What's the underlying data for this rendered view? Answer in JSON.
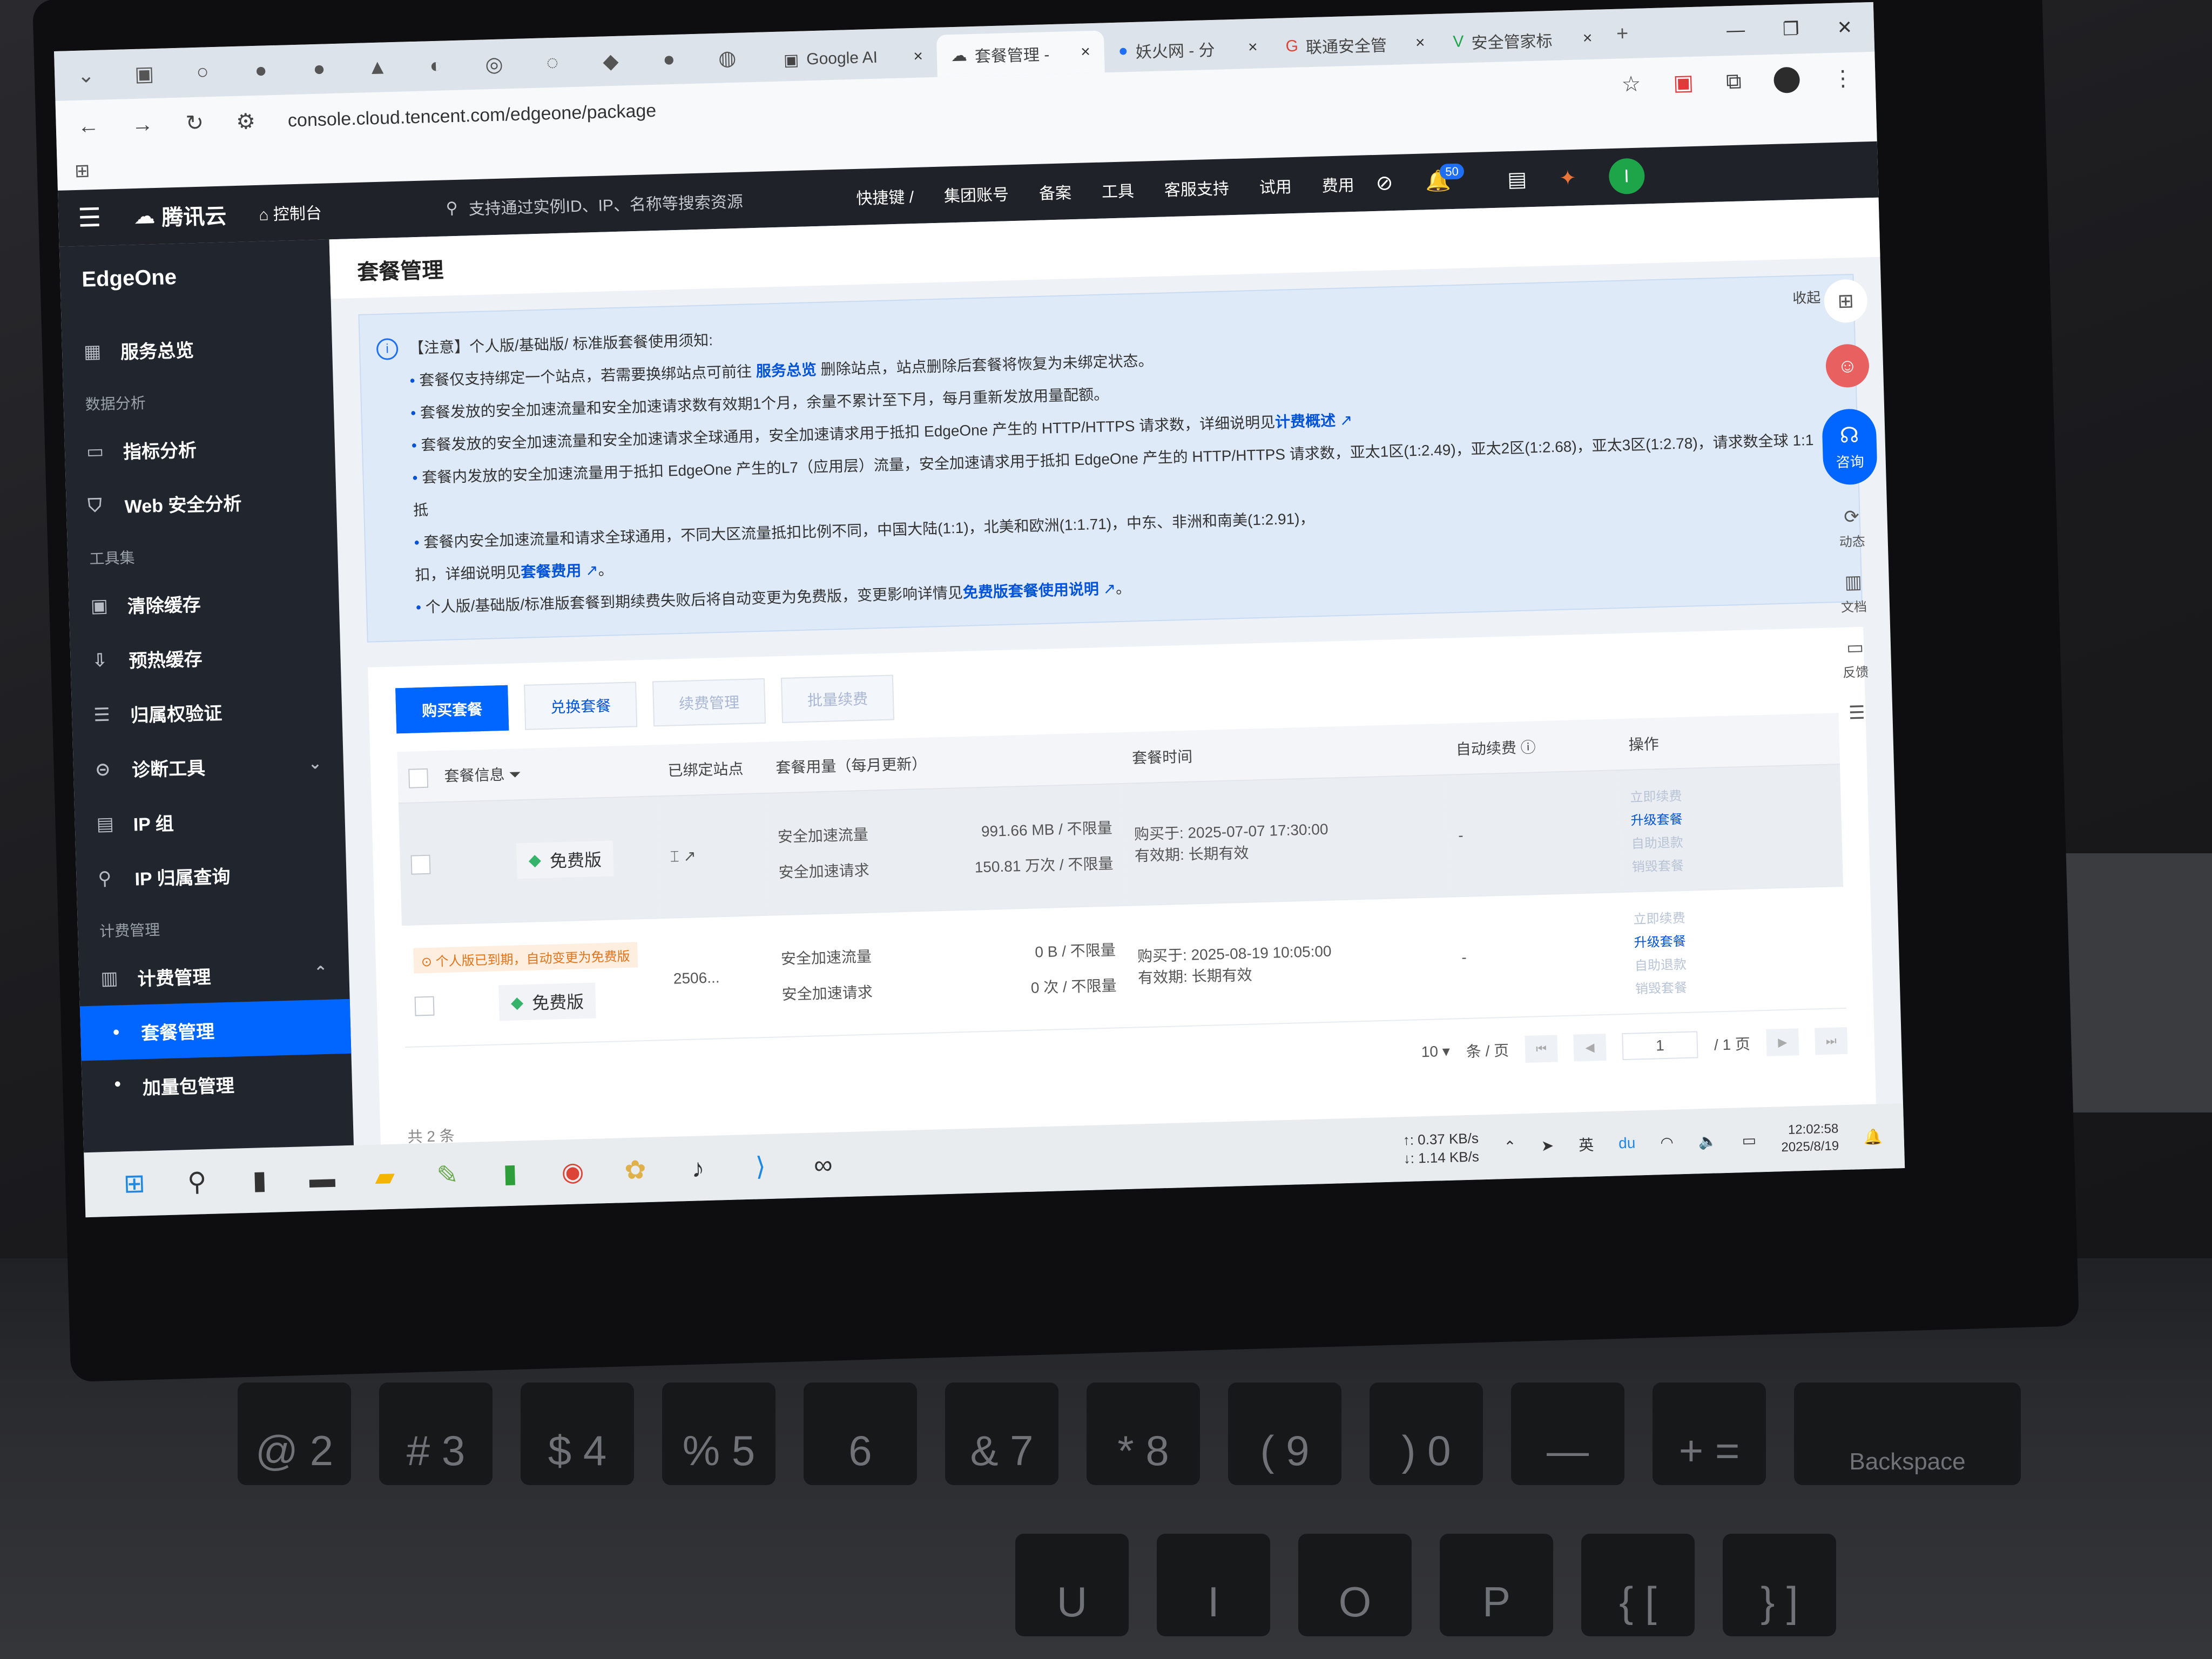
{
  "browser": {
    "tabs": [
      {
        "label": "Google AI",
        "icon": "google-ai-icon"
      },
      {
        "label": "套餐管理 -",
        "icon": "tencent-cloud-icon",
        "active": true
      },
      {
        "label": "妖火网 - 分",
        "icon": "chat-bubble-icon"
      },
      {
        "label": "联通安全管",
        "icon": "google-icon"
      },
      {
        "label": "安全管家标",
        "icon": "v-logo-icon"
      }
    ],
    "url": "console.cloud.tencent.com/edgeone/package"
  },
  "topbar": {
    "brand": "腾讯云",
    "console_label": "控制台",
    "search_placeholder": "支持通过实例ID、IP、名称等搜索资源",
    "menu": [
      "快捷键 /",
      "集团账号",
      "备案",
      "工具",
      "客服支持",
      "试用",
      "费用"
    ],
    "notification_count": "50",
    "avatar_letter": "I"
  },
  "sidebar": {
    "product": "EdgeOne",
    "overview": "服务总览",
    "groups": [
      {
        "title": "数据分析",
        "items": [
          "指标分析",
          "Web 安全分析"
        ]
      },
      {
        "title": "工具集",
        "items": [
          "清除缓存",
          "预热缓存",
          "归属权验证",
          "诊断工具",
          "IP 组",
          "IP 归属查询"
        ]
      },
      {
        "title": "计费管理",
        "items": [
          "计费管理"
        ]
      }
    ],
    "billing_children": [
      "套餐管理",
      "加量包管理"
    ]
  },
  "page": {
    "title": "套餐管理",
    "collapse_label": "收起",
    "notice": {
      "heading": "【注意】个人版/基础版/ 标准版套餐使用须知:",
      "line1_a": "套餐仅支持绑定一个站点，若需要换绑站点可前往",
      "line1_link": "服务总览",
      "line1_b": "删除站点，站点删除后套餐将恢复为未绑定状态。",
      "line2_a": "套餐发放的安全加速流量和安全加速请求数有效期1个月，余量不累计至下月，每月重新发放用量配额。",
      "line3_a": "套餐发放的安全加速流量和安全加速请求全球通用，安全加速请求用于抵扣 EdgeOne 产生的 HTTP/HTTPS 请求数，详细说明见",
      "line3_link": "计费概述",
      "line4": "套餐内发放的安全加速流量用于抵扣 EdgeOne 产生的L7（应用层）流量，安全加速请求用于抵扣 EdgeOne 产生的 HTTP/HTTPS 请求数，亚太1区(1:2.49)，亚太2区(1:2.68)，亚太3区(1:2.78)，请求数全球 1:1 抵",
      "line5_a": "套餐内安全加速流量和请求全球通用，不同大区流量抵扣比例不同，中国大陆(1:1)，北美和欧洲(1:1.71)，中东、非洲和南美(1:2.91)，",
      "line5_b": "扣，详细说明见",
      "line5_link": "套餐费用",
      "line6_a": "个人版/基础版/标准版套餐到期续费失败后将自动变更为免费版，变更影响详情见",
      "line6_link": "免费版套餐使用说明"
    },
    "buttons": {
      "buy": "购买套餐",
      "exchange": "兑换套餐",
      "renew_manage": "续费管理",
      "batch_renew": "批量续费"
    },
    "table": {
      "headers": [
        "套餐信息",
        "已绑定站点",
        "套餐用量（每月更新）",
        "套餐时间",
        "自动续费",
        "操作"
      ],
      "rows": [
        {
          "plan": "免费版",
          "site": "",
          "traffic_label": "安全加速流量",
          "traffic_value": "991.66 MB / 不限量",
          "requests_label": "安全加速请求",
          "requests_value": "150.81 万次 / 不限量",
          "purchased": "购买于: 2025-07-07 17:30:00",
          "validity": "有效期: 长期有效",
          "auto_renew": "-",
          "ops": [
            "立即续费",
            "升级套餐",
            "自助退款",
            "销毁套餐"
          ]
        },
        {
          "tag": "个人版已到期，自动变更为免费版",
          "plan": "免费版",
          "site": "2506...",
          "traffic_label": "安全加速流量",
          "traffic_value": "0 B / 不限量",
          "requests_label": "安全加速请求",
          "requests_value": "0 次 / 不限量",
          "purchased": "购买于: 2025-08-19 10:05:00",
          "validity": "有效期: 长期有效",
          "auto_renew": "-",
          "ops": [
            "立即续费",
            "升级套餐",
            "自助退款",
            "销毁套餐"
          ]
        }
      ]
    },
    "pager": {
      "page_size": "10",
      "per_page_label": "条 / 页",
      "current": "1",
      "total_pages": "/ 1 页"
    },
    "total": "共 2 条"
  },
  "floatbar": {
    "consult": "咨询",
    "items": [
      "动态",
      "文档",
      "反馈"
    ]
  },
  "taskbar": {
    "net_up": "↑: 0.37 KB/s",
    "net_down": "↓: 1.14 KB/s",
    "time": "12:02:58",
    "date": "2025/8/19"
  },
  "keyboard": {
    "keys": [
      "@\n2",
      "#\n3",
      "$\n4",
      "%\n5",
      "6",
      "&\n7",
      "*\n8",
      "(\n9",
      ")\n0",
      "—",
      "+\n=",
      "Backspace",
      "U",
      "I",
      "O",
      "P",
      "{\n[",
      "}\n]"
    ]
  }
}
